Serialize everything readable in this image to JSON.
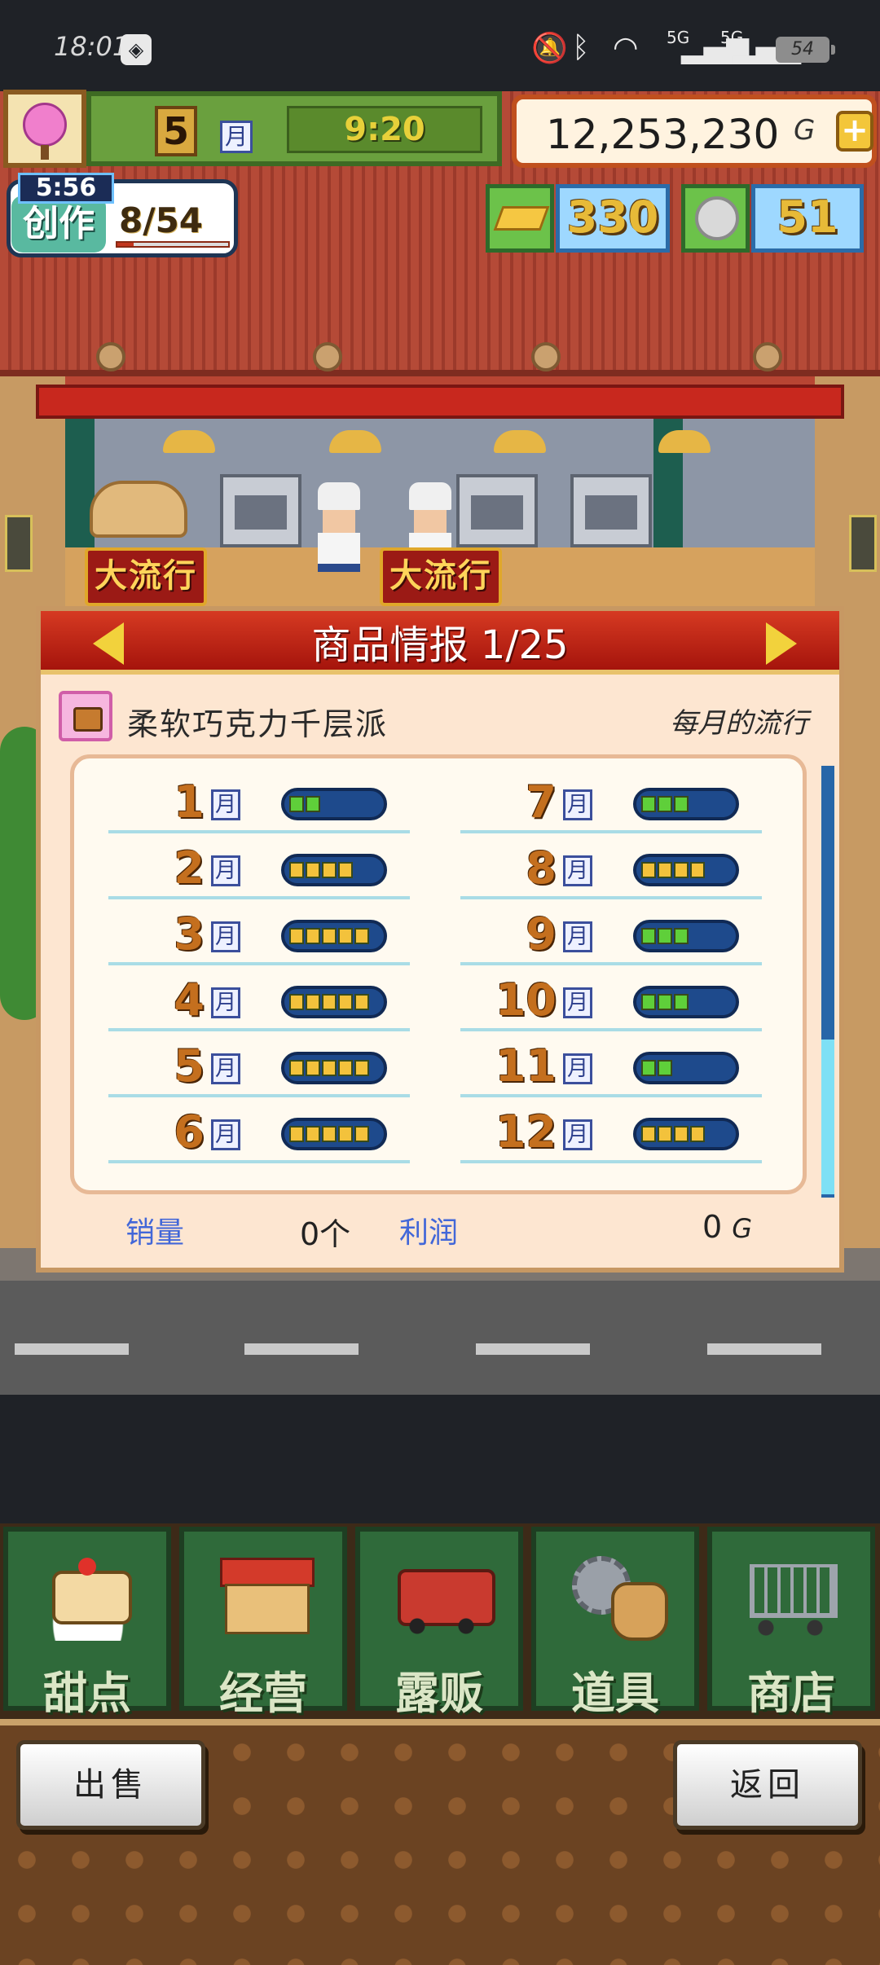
{
  "status_bar": {
    "time": "18:01",
    "network_1": "5G",
    "network_2": "5G",
    "battery": "54"
  },
  "hud": {
    "month": "5",
    "month_unit": "月",
    "clock": "9:20",
    "money": "12,253,230",
    "money_unit": "G",
    "money_add_icon": "plus-icon",
    "create": {
      "timer": "5:56",
      "label": "创作",
      "count": "8/54",
      "progress": 0.15
    },
    "gold_bars": "330",
    "medals": "51"
  },
  "shop": {
    "trend_sign_1": "大流行",
    "trend_sign_2": "大流行"
  },
  "panel": {
    "title": "商品情报 1/25",
    "product_name": "柔软巧克力千层派",
    "trend_label": "每月的流行",
    "month_unit": "月",
    "months": [
      {
        "month": "1",
        "level": 2,
        "color": "green"
      },
      {
        "month": "2",
        "level": 4,
        "color": "yellow"
      },
      {
        "month": "3",
        "level": 5,
        "color": "yellow"
      },
      {
        "month": "4",
        "level": 5,
        "color": "yellow"
      },
      {
        "month": "5",
        "level": 5,
        "color": "yellow"
      },
      {
        "month": "6",
        "level": 5,
        "color": "yellow"
      },
      {
        "month": "7",
        "level": 3,
        "color": "green"
      },
      {
        "month": "8",
        "level": 4,
        "color": "yellow"
      },
      {
        "month": "9",
        "level": 3,
        "color": "green"
      },
      {
        "month": "10",
        "level": 3,
        "color": "green"
      },
      {
        "month": "11",
        "level": 2,
        "color": "green"
      },
      {
        "month": "12",
        "level": 4,
        "color": "yellow"
      }
    ],
    "sales_label": "销量",
    "sales_value": "0个",
    "profit_label": "利润",
    "profit_value": "0",
    "profit_unit": "G"
  },
  "nav": {
    "items": [
      {
        "label": "甜点",
        "icon": "cake-icon"
      },
      {
        "label": "经营",
        "icon": "shop-icon"
      },
      {
        "label": "露贩",
        "icon": "food-truck-icon"
      },
      {
        "label": "道具",
        "icon": "tools-icon"
      },
      {
        "label": "商店",
        "icon": "cart-icon"
      }
    ]
  },
  "footer": {
    "sell_label": "出售",
    "back_label": "返回"
  },
  "colors": {
    "level_green": "#5fcf3a",
    "level_yellow": "#f3c23c",
    "panel_header": "#b71d12",
    "accent_blue": "#4267d8"
  }
}
